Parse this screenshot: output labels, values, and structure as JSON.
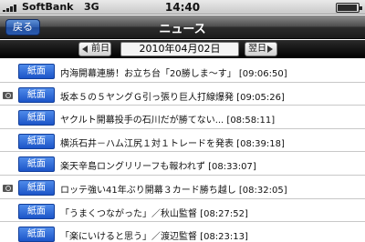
{
  "status_bar": {
    "carrier": "SoftBank",
    "network": "3G",
    "time": "14:40",
    "battery_level": 0.95
  },
  "header": {
    "back_label": "戻る",
    "title": "ニュース"
  },
  "date_nav": {
    "prev_label": "前日",
    "date": "2010年04月02日",
    "next_label": "翌日"
  },
  "news": {
    "badge_label": "紙面",
    "items": [
      {
        "headline": "内海開幕連勝！お立ち台「20勝しま～す」 [09:06:50]",
        "has_photo": false
      },
      {
        "headline": "坂本５の５ヤングＧ引っ張り巨人打線爆発 [09:05:26]",
        "has_photo": true
      },
      {
        "headline": "ヤクルト開幕投手の石川だが勝てない... [08:58:11]",
        "has_photo": false
      },
      {
        "headline": "横浜石井－ハム江尻１対１トレードを発表 [08:39:18]",
        "has_photo": false
      },
      {
        "headline": "楽天辛島ロングリリーフも報われず [08:33:07]",
        "has_photo": false
      },
      {
        "headline": "ロッテ強い41年ぶり開幕３カード勝ち越し [08:32:05]",
        "has_photo": true
      },
      {
        "headline": "「うまくつながった」／秋山監督 [08:27:52]",
        "has_photo": false
      },
      {
        "headline": "「楽にいけると思う」／渡辺監督 [08:23:13]",
        "has_photo": false
      }
    ]
  },
  "colors": {
    "badge_blue": "#1c55c8",
    "back_button_blue": "#2f5eb0",
    "title_bar": "#1c1c1c"
  }
}
